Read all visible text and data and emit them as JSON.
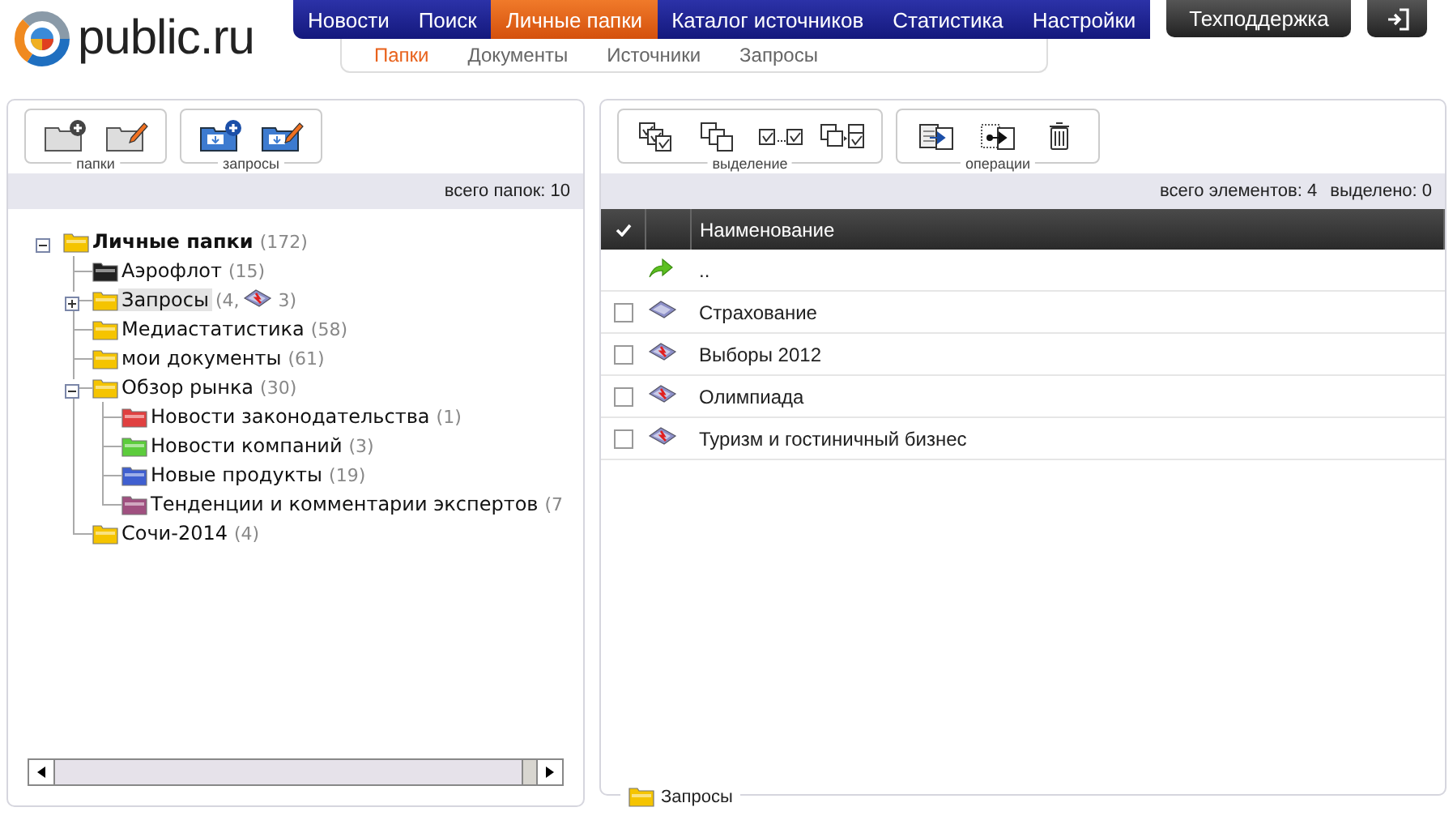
{
  "logo": {
    "text": "public.ru"
  },
  "nav": [
    {
      "label": "Новости",
      "selected": false
    },
    {
      "label": "Поиск",
      "selected": false
    },
    {
      "label": "Личные папки",
      "selected": true
    },
    {
      "label": "Каталог источников",
      "selected": false
    },
    {
      "label": "Статистика",
      "selected": false
    },
    {
      "label": "Настройки",
      "selected": false
    }
  ],
  "support_button": "Техподдержка",
  "subnav": [
    {
      "label": "Папки",
      "selected": true
    },
    {
      "label": "Документы",
      "selected": false
    },
    {
      "label": "Источники",
      "selected": false
    },
    {
      "label": "Запросы",
      "selected": false
    }
  ],
  "left_panel": {
    "toolbar": [
      {
        "label": "папки",
        "buttons": [
          {
            "kind": "folder-add"
          },
          {
            "kind": "folder-edit"
          }
        ]
      },
      {
        "label": "запросы",
        "buttons": [
          {
            "kind": "query-add"
          },
          {
            "kind": "query-edit"
          }
        ]
      }
    ],
    "status": "всего папок: 10",
    "tree": [
      {
        "name": "Личные папки",
        "count": "(172)",
        "color": "#f5c400",
        "expanded": true,
        "selected": false,
        "children": [
          {
            "name": "Аэрофлот",
            "count": "(15)",
            "color": "#202020",
            "selected": false
          },
          {
            "name": "Запросы",
            "count": "(4,",
            "count_2": "3)",
            "color": "#f5c400",
            "expanded": false,
            "selected": true
          },
          {
            "name": "Медиастатистика",
            "count": "(58)",
            "color": "#f5c400",
            "selected": false
          },
          {
            "name": "мои документы",
            "count": "(61)",
            "color": "#f5c400",
            "selected": false
          },
          {
            "name": "Обзор рынка",
            "count": "(30)",
            "color": "#f5c400",
            "expanded": true,
            "selected": false,
            "children": [
              {
                "name": "Новости законодательства",
                "count": "(1)",
                "color": "#e04040",
                "selected": false
              },
              {
                "name": "Новости компаний",
                "count": "(3)",
                "color": "#5ccc3c",
                "selected": false
              },
              {
                "name": "Новые продукты",
                "count": "(19)",
                "color": "#3f5fd0",
                "selected": false
              },
              {
                "name": "Тенденции и комментарии экспертов",
                "count": "(7",
                "color": "#a05080",
                "selected": false
              }
            ]
          },
          {
            "name": "Сочи-2014",
            "count": "(4)",
            "color": "#f5c400",
            "selected": false
          }
        ]
      }
    ]
  },
  "right_panel": {
    "toolbar": [
      {
        "label": "выделение",
        "buttons": [
          {
            "kind": "select-all"
          },
          {
            "kind": "deselect"
          },
          {
            "kind": "select-range"
          },
          {
            "kind": "invert"
          }
        ]
      },
      {
        "label": "операции",
        "buttons": [
          {
            "kind": "copy"
          },
          {
            "kind": "move"
          },
          {
            "kind": "delete"
          }
        ]
      }
    ],
    "status": [
      "всего элементов: 4",
      "выделено: 0"
    ],
    "table": {
      "columns": [
        "Наименование"
      ],
      "rows": [
        {
          "kind": "up",
          "name": ".."
        },
        {
          "kind": "item",
          "name": "Страхование",
          "checked": false
        },
        {
          "kind": "item-marked",
          "name": "Выборы 2012",
          "checked": false
        },
        {
          "kind": "item-marked",
          "name": "Олимпиада",
          "checked": false
        },
        {
          "kind": "item-marked",
          "name": "Туризм и гостиничный бизнес",
          "checked": false
        }
      ]
    },
    "footer_label": "Запросы"
  }
}
